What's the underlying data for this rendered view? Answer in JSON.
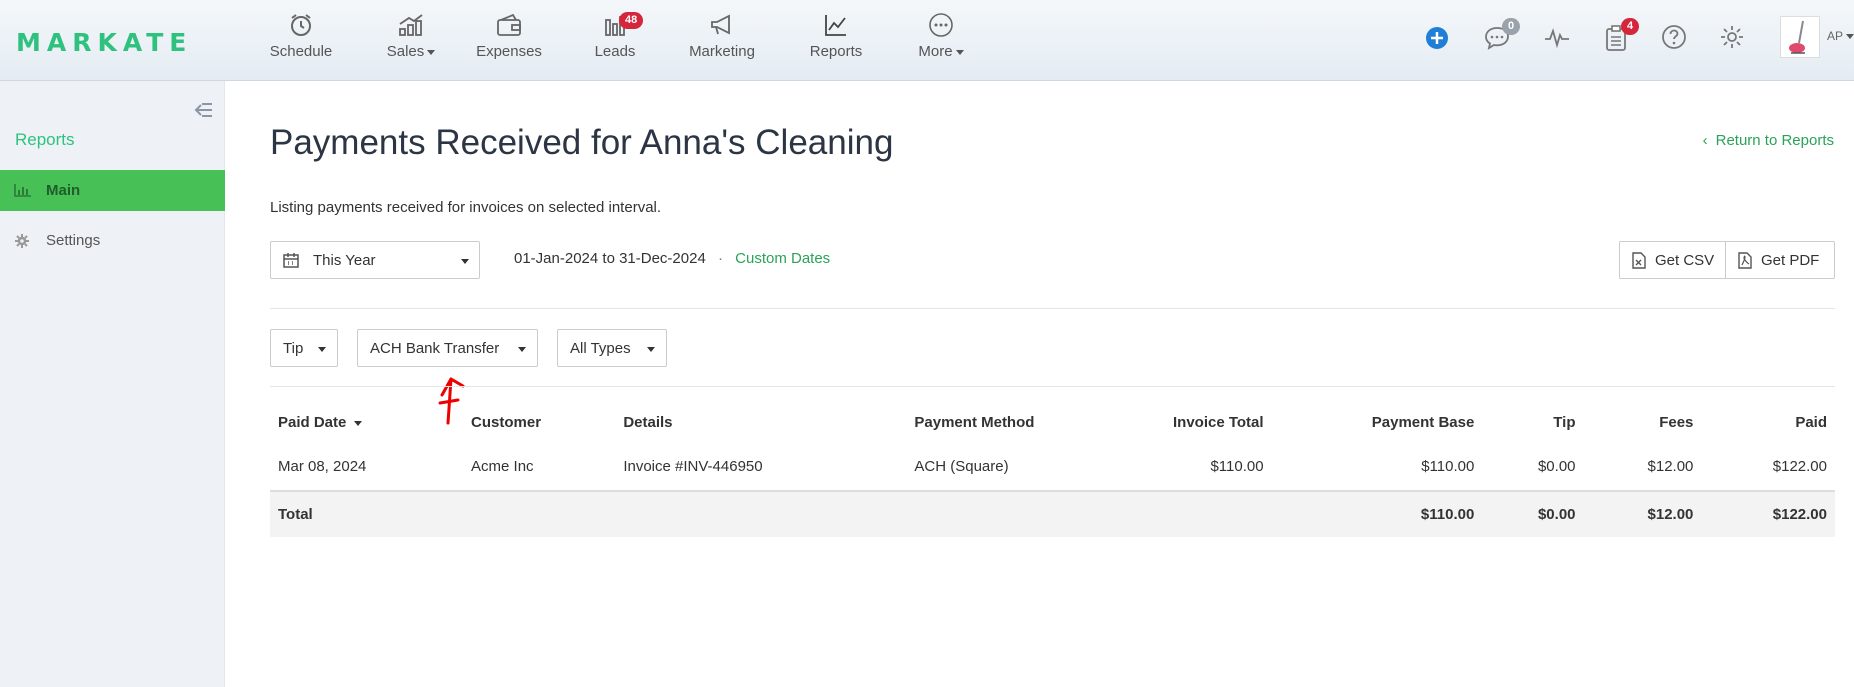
{
  "brand": {
    "logo": "MARKATE",
    "accent": "#2ec27e"
  },
  "nav": {
    "items": [
      {
        "label": "Schedule",
        "icon": "alarm-clock-icon"
      },
      {
        "label": "Sales",
        "icon": "chart-coins-icon",
        "dropdown": true
      },
      {
        "label": "Expenses",
        "icon": "wallet-icon"
      },
      {
        "label": "Leads",
        "icon": "funnel-bars-icon",
        "badge": "48"
      },
      {
        "label": "Marketing",
        "icon": "megaphone-icon"
      },
      {
        "label": "Reports",
        "icon": "line-chart-icon"
      },
      {
        "label": "More",
        "icon": "ellipsis-icon",
        "dropdown": true
      }
    ],
    "messages_badge": "0",
    "tasks_badge": "4",
    "user_initials": "AP"
  },
  "sidebar": {
    "title": "Reports",
    "items": [
      {
        "label": "Main",
        "icon": "bar-chart-icon",
        "active": true
      },
      {
        "label": "Settings",
        "icon": "gear-icon",
        "active": false
      }
    ]
  },
  "main": {
    "title": "Payments Received for Anna's Cleaning",
    "return_link": "Return to Reports",
    "subtitle": "Listing payments received for invoices on selected interval.",
    "period_select": "This Year",
    "date_range": "01-Jan-2024 to 31-Dec-2024",
    "separator": "·",
    "custom_dates": "Custom Dates",
    "get_csv": "Get CSV",
    "get_pdf": "Get PDF",
    "filters": {
      "tip": "Tip",
      "method": "ACH Bank Transfer",
      "types": "All Types"
    }
  },
  "table": {
    "headers": [
      "Paid Date",
      "Customer",
      "Details",
      "Payment Method",
      "Invoice Total",
      "Payment Base",
      "Tip",
      "Fees",
      "Paid"
    ],
    "rows": [
      [
        "Mar 08, 2024",
        "Acme Inc",
        "Invoice #INV-446950",
        "ACH (Square)",
        "$110.00",
        "$110.00",
        "$0.00",
        "$12.00",
        "$122.00"
      ]
    ],
    "total": {
      "label": "Total",
      "payment_base": "$110.00",
      "tip": "$0.00",
      "fees": "$12.00",
      "paid": "$122.00"
    }
  }
}
